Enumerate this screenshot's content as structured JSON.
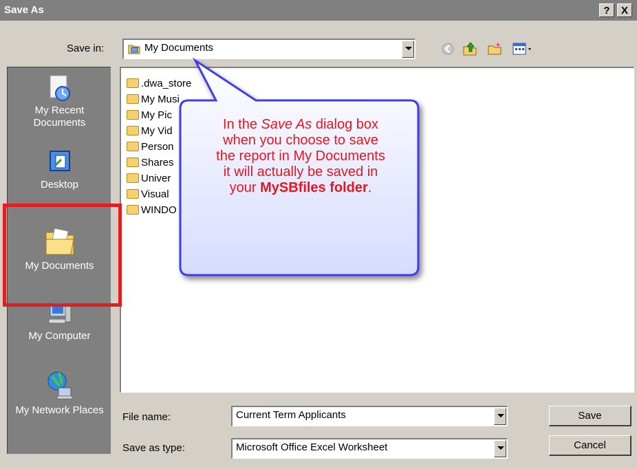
{
  "window": {
    "title": "Save As",
    "help_label": "?",
    "close_label": "X"
  },
  "save_in": {
    "label": "Save in:",
    "value": "My Documents"
  },
  "toolbar": {
    "back_icon": "back-arrow-icon",
    "up_icon": "up-folder-icon",
    "new_folder_icon": "new-folder-icon",
    "views_icon": "views-menu-icon"
  },
  "places": [
    {
      "label": "My Recent Documents",
      "icon": "recent-documents-icon"
    },
    {
      "label": "Desktop",
      "icon": "desktop-icon"
    },
    {
      "label": "My Documents",
      "icon": "my-documents-icon"
    },
    {
      "label": "My Computer",
      "icon": "my-computer-icon"
    },
    {
      "label": "My Network Places",
      "icon": "network-places-icon"
    }
  ],
  "files": [
    ".dwa_store",
    "My Musi",
    "My Pic",
    "My Vid",
    "Person",
    "Shares",
    "Univer",
    "Visual",
    "WINDO"
  ],
  "file_name": {
    "label": "File name:",
    "value": "Current Term Applicants"
  },
  "save_as_type": {
    "label": "Save as type:",
    "value": "Microsoft Office Excel Worksheet"
  },
  "buttons": {
    "save": "Save",
    "cancel": "Cancel"
  },
  "callout": {
    "line1_prefix": "In the ",
    "line1_italic": "Save As",
    "line1_suffix": " dialog box",
    "line2": "when you choose to save",
    "line3": "the report in My Documents",
    "line4": "it will actually be saved in",
    "line5_prefix": "your ",
    "line5_bold": "MySBfiles folder",
    "line5_suffix": ".",
    "text_color": "#e8141e",
    "bubble_color": "#3c3cf0"
  },
  "highlight_color": "#e02020"
}
